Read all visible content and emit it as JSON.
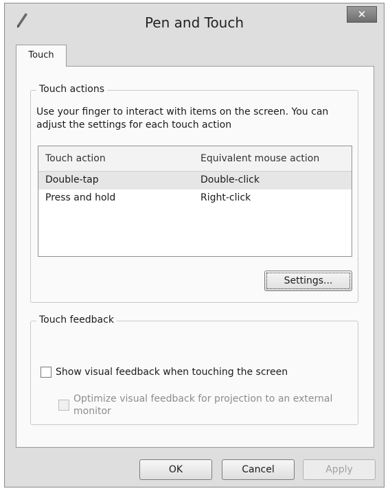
{
  "window": {
    "title": "Pen and Touch",
    "close_glyph": "✕"
  },
  "tabs": [
    {
      "label": "Touch",
      "selected": true
    }
  ],
  "touch_actions": {
    "group_label": "Touch actions",
    "description": "Use your finger to interact with items on the screen. You can adjust the settings for each touch action",
    "columns": [
      "Touch action",
      "Equivalent mouse action"
    ],
    "rows": [
      {
        "action": "Double-tap",
        "mouse": "Double-click",
        "selected": true
      },
      {
        "action": "Press and hold",
        "mouse": "Right-click",
        "selected": false
      }
    ],
    "settings_button": "Settings..."
  },
  "touch_feedback": {
    "group_label": "Touch feedback",
    "show_feedback": {
      "label": "Show visual feedback when touching the screen",
      "checked": false
    },
    "optimize_feedback": {
      "label": "Optimize visual feedback for projection to an external monitor",
      "checked": false,
      "disabled": true
    }
  },
  "footer": {
    "ok": "OK",
    "cancel": "Cancel",
    "apply": "Apply"
  },
  "icons": {
    "app": "pen-icon",
    "close": "close-icon"
  }
}
